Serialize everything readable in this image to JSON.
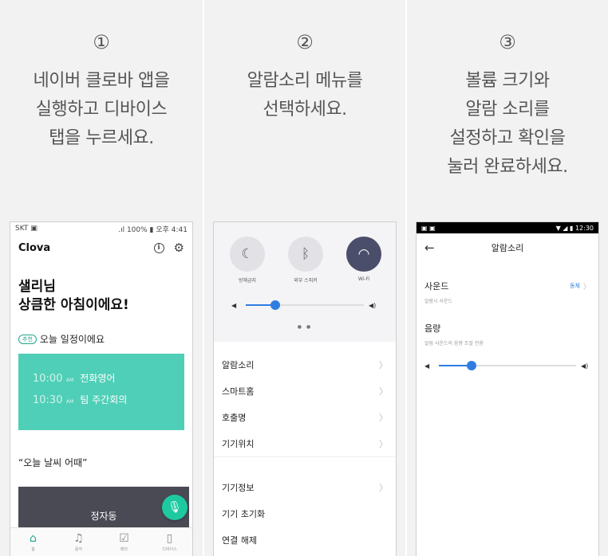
{
  "steps": [
    {
      "num": "①",
      "text": "네이버 클로바 앱을\n실행하고 디바이스\n탭을 누르세요."
    },
    {
      "num": "②",
      "text": "알람소리 메뉴를\n선택하세요."
    },
    {
      "num": "③",
      "text": "볼륨 크기와\n알람 소리를\n설정하고 확인을\n눌러 완료하세요."
    }
  ],
  "screen1": {
    "status_left": "SKT",
    "status_right": ".ıl 100% ▮ 오후 4:41",
    "logo": "Clova",
    "info_icon": "i",
    "greeting_line1": "샐리님",
    "greeting_line2": "상큼한 아침이에요!",
    "recommend_badge": "추천",
    "schedule_title": "오늘 일정이에요",
    "schedule": [
      {
        "time": "10:00",
        "ampm": "AM",
        "name": "전화영어"
      },
      {
        "time": "10:30",
        "ampm": "AM",
        "name": "팀 주간회의"
      }
    ],
    "weather_title": "“오늘 날씨 어때”",
    "weather_location": "정자동",
    "nav": [
      {
        "icon": "⌂",
        "label": "홈"
      },
      {
        "icon": "♫",
        "label": "음악"
      },
      {
        "icon": "☑",
        "label": "메타"
      },
      {
        "icon": "▯",
        "label": "디바이스"
      }
    ]
  },
  "screen2": {
    "toggles": [
      {
        "icon": "☾",
        "label": "방해금지"
      },
      {
        "icon": "ᛒ",
        "label": "외부 스피커"
      },
      {
        "icon": "◠",
        "label": "Wi-Fi"
      }
    ],
    "volume_level": 0.25,
    "page_dots": "● ●",
    "menu_primary": [
      "알람소리",
      "스마트홈",
      "호출명",
      "기기위치"
    ],
    "menu_secondary": [
      "기기정보",
      "기기 초기화",
      "연결 해제"
    ]
  },
  "screen3": {
    "status_right": "▼ ◢ ▮ 12:30",
    "title": "알람소리",
    "sound_label": "사운드",
    "sound_sub": "알람시 사운드",
    "sound_value": "동체",
    "volume_label": "음량",
    "volume_sub": "알림 사운드의 음량 조절 전용",
    "volume_level": 0.24
  },
  "colors": {
    "teal": "#4fcfb7",
    "blue": "#2f7de1",
    "dark": "#4a4e6a"
  }
}
